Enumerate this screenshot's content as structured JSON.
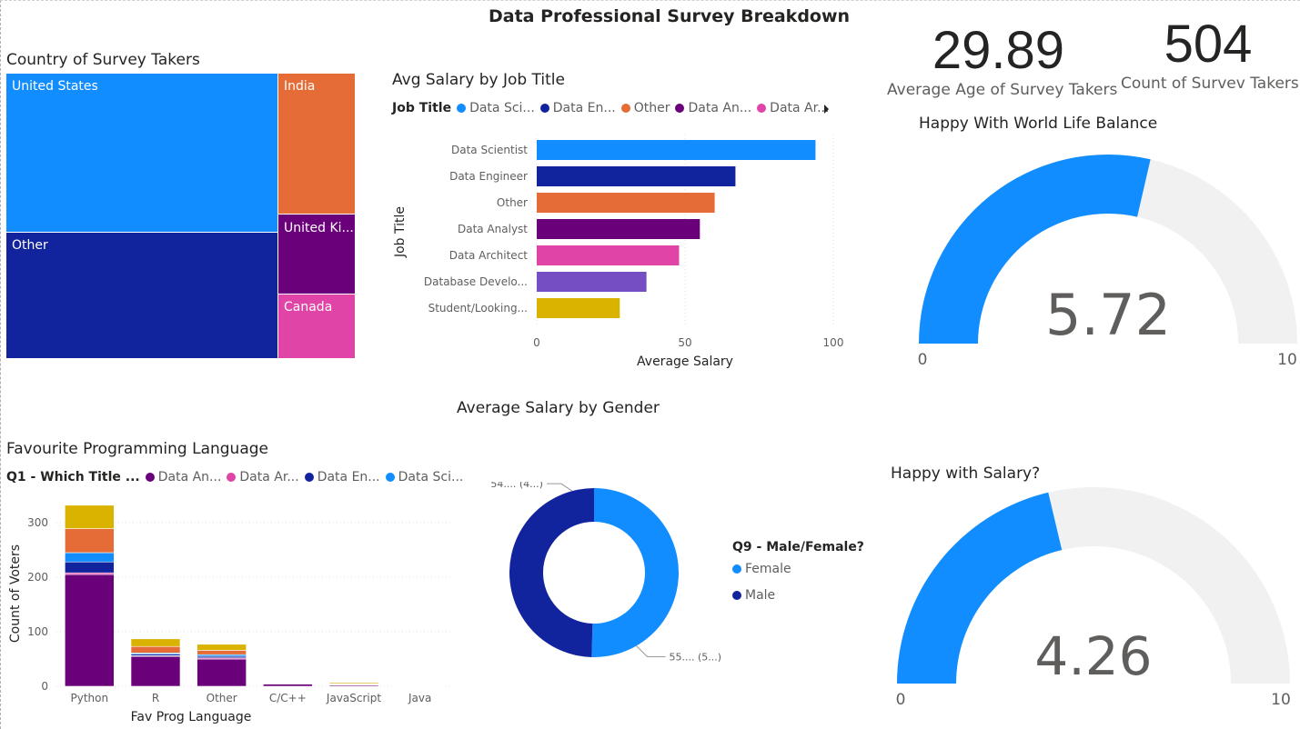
{
  "page": {
    "title": "Data Professional Survey Breakdown"
  },
  "colors": {
    "blue": "#118dff",
    "navy": "#12239e",
    "orange": "#e66c37",
    "purple": "#6b007b",
    "pink": "#e044a7",
    "violet": "#744ec2",
    "gold": "#d9b300",
    "grey": "#f1f1f1"
  },
  "kpis": {
    "avg_age": {
      "value": "29.89",
      "label": "Average Age of Survey Takers"
    },
    "count": {
      "value": "504",
      "label": "Count of Survev Takers"
    }
  },
  "treemap": {
    "title": "Country of Survey Takers",
    "cells": [
      {
        "label": "United States",
        "color": "#118dff"
      },
      {
        "label": "Other",
        "color": "#12239e"
      },
      {
        "label": "India",
        "color": "#e66c37"
      },
      {
        "label": "United Ki...",
        "color": "#6b007b"
      },
      {
        "label": "Canada",
        "color": "#e044a7"
      }
    ]
  },
  "chart_data": [
    {
      "type": "bar",
      "orientation": "horizontal",
      "title": "Avg Salary by Job Title",
      "legend": {
        "title": "Job Title",
        "placement": "top",
        "items": [
          "Data Sci...",
          "Data En...",
          "Other",
          "Data An...",
          "Data Ar..."
        ]
      },
      "categories": [
        "Data Scientist",
        "Data Engineer",
        "Other",
        "Data Analyst",
        "Data Architect",
        "Database Develo...",
        "Student/Looking..."
      ],
      "values": [
        94,
        67,
        60,
        55,
        48,
        37,
        28
      ],
      "colors": [
        "#118dff",
        "#12239e",
        "#e66c37",
        "#6b007b",
        "#e044a7",
        "#744ec2",
        "#d9b300"
      ],
      "xlabel": "Average Salary",
      "ylabel": "Job Title",
      "xlim": [
        0,
        100
      ],
      "xticks": [
        "0",
        "50",
        "100"
      ],
      "grid": true
    },
    {
      "type": "bar",
      "stacked": true,
      "title": "Favourite Programming Language",
      "legend": {
        "title": "Q1 - Which Title ...",
        "placement": "top",
        "items": [
          "Data An...",
          "Data Ar...",
          "Data En...",
          "Data Sci..."
        ]
      },
      "categories": [
        "Python",
        "R",
        "Other",
        "C/C++",
        "JavaScript",
        "Java"
      ],
      "series": [
        {
          "name": "Data An...",
          "color": "#6b007b",
          "values": [
            205,
            55,
            50,
            4,
            2,
            1
          ]
        },
        {
          "name": "Data Ar...",
          "color": "#e044a7",
          "values": [
            3,
            1,
            2,
            1,
            0,
            0
          ]
        },
        {
          "name": "Data En...",
          "color": "#12239e",
          "values": [
            20,
            3,
            3,
            1,
            1,
            0
          ]
        },
        {
          "name": "Data Sci...",
          "color": "#118dff",
          "values": [
            17,
            2,
            3,
            0,
            1,
            1
          ]
        },
        {
          "color": "#e66c37",
          "values": [
            44,
            12,
            8,
            1,
            1,
            0
          ]
        },
        {
          "color": "#d9b300",
          "values": [
            43,
            14,
            11,
            1,
            2,
            1
          ]
        }
      ],
      "xlabel": "Fav Prog Language",
      "ylabel": "Count of Voters",
      "ylim": [
        0,
        340
      ],
      "yticks": [
        "0",
        "100",
        "200",
        "300"
      ],
      "grid": true
    },
    {
      "type": "pie",
      "donut": true,
      "title": "Average Salary by Gender",
      "legend": {
        "title": "Q9 - Male/Female?",
        "placement": "right",
        "items": [
          "Female",
          "Male"
        ]
      },
      "slices": [
        {
          "name": "Female",
          "value": 55,
          "color": "#118dff",
          "label": "55.... (5...)"
        },
        {
          "name": "Male",
          "value": 54,
          "color": "#12239e",
          "label": "54.... (4...)"
        }
      ]
    },
    {
      "type": "gauge",
      "title": "Happy With World Life Balance",
      "value": 5.72,
      "value_label": "5.72",
      "min": 0,
      "max": 10,
      "min_label": "0",
      "max_label": "10"
    },
    {
      "type": "gauge",
      "title": "Happy with Salary?",
      "value": 4.26,
      "value_label": "4.26",
      "min": 0,
      "max": 10,
      "min_label": "0",
      "max_label": "10"
    }
  ]
}
